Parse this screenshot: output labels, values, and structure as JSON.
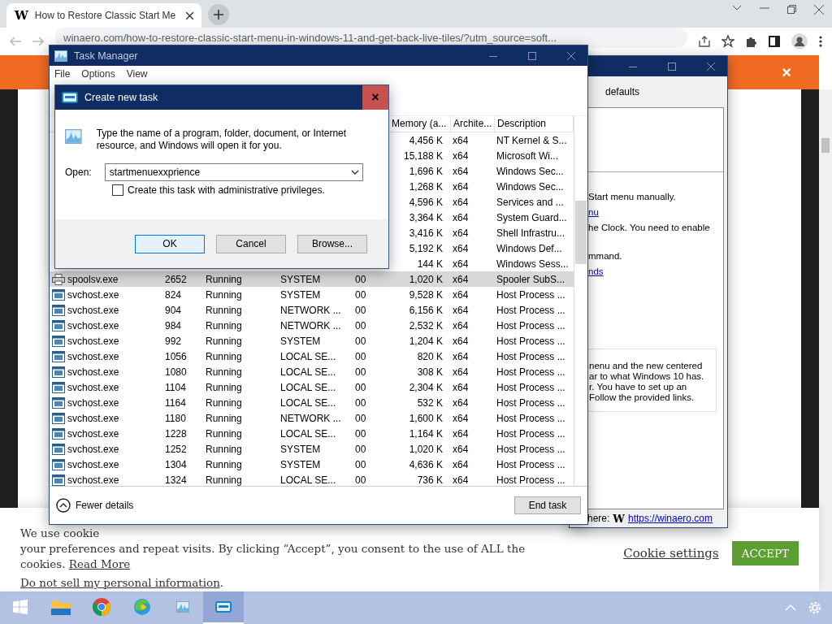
{
  "browser": {
    "tab": {
      "favicon": "W",
      "title": "How to Restore Classic Start Me"
    },
    "url": "winaero.com/how-to-restore-classic-start-menu-in-windows-11-and-get-back-live-tiles/?utm_source=soft..."
  },
  "page": {
    "banner_close": "×"
  },
  "settings_window": {
    "section": "defaults",
    "lines": [
      {
        "kind": "text",
        "text": "Start menu manually."
      },
      {
        "kind": "link",
        "text": "nu"
      },
      {
        "kind": "text",
        "text": "he Clock. You need to enable"
      },
      {
        "kind": "gap"
      },
      {
        "kind": "text",
        "text": "mmand."
      },
      {
        "kind": "link",
        "text": "nds"
      }
    ],
    "note": [
      "nenu and the new centered",
      "ar to what Windows 10 has.",
      "r. You have to set up an",
      "Follow the provided links."
    ],
    "footer_label": "here:",
    "footer_logo": "W",
    "footer_link": "https://winaero.com"
  },
  "task_manager": {
    "title": "Task Manager",
    "menu": [
      "File",
      "Options",
      "View"
    ],
    "columns": [
      "Memory (a...",
      "Archite...",
      "Description"
    ],
    "rows": [
      {
        "memory": "4,456 K",
        "arch": "x64",
        "description": "NT Kernel & S...",
        "selected": false
      },
      {
        "memory": "15,188 K",
        "arch": "x64",
        "description": "Microsoft Wi...",
        "selected": false
      },
      {
        "memory": "1,696 K",
        "arch": "x64",
        "description": "Windows Sec...",
        "selected": false
      },
      {
        "memory": "1,268 K",
        "arch": "x64",
        "description": "Windows Sec...",
        "selected": false
      },
      {
        "memory": "4,596 K",
        "arch": "x64",
        "description": "Services and ...",
        "selected": false
      },
      {
        "memory": "3,364 K",
        "arch": "x64",
        "description": "System Guard...",
        "selected": false
      },
      {
        "memory": "3,416 K",
        "arch": "x64",
        "description": "Shell Infrastru...",
        "selected": false
      },
      {
        "memory": "5,192 K",
        "arch": "x64",
        "description": "Windows Def...",
        "selected": false
      },
      {
        "memory": "144 K",
        "arch": "x64",
        "description": "Windows Sess...",
        "selected": false
      },
      {
        "kind": "printer",
        "name": "spoolsv.exe",
        "pid": "2652",
        "status": "Running",
        "user": "SYSTEM",
        "cpu": "00",
        "memory": "1,020 K",
        "arch": "x64",
        "description": "Spooler SubS...",
        "selected": true
      },
      {
        "kind": "service",
        "name": "svchost.exe",
        "pid": "824",
        "status": "Running",
        "user": "SYSTEM",
        "cpu": "00",
        "memory": "9,528 K",
        "arch": "x64",
        "description": "Host Process ...",
        "selected": false
      },
      {
        "kind": "service",
        "name": "svchost.exe",
        "pid": "904",
        "status": "Running",
        "user": "NETWORK ...",
        "cpu": "00",
        "memory": "6,156 K",
        "arch": "x64",
        "description": "Host Process ...",
        "selected": false
      },
      {
        "kind": "service",
        "name": "svchost.exe",
        "pid": "984",
        "status": "Running",
        "user": "NETWORK ...",
        "cpu": "00",
        "memory": "2,532 K",
        "arch": "x64",
        "description": "Host Process ...",
        "selected": false
      },
      {
        "kind": "service",
        "name": "svchost.exe",
        "pid": "992",
        "status": "Running",
        "user": "SYSTEM",
        "cpu": "00",
        "memory": "1,204 K",
        "arch": "x64",
        "description": "Host Process ...",
        "selected": false
      },
      {
        "kind": "service",
        "name": "svchost.exe",
        "pid": "1056",
        "status": "Running",
        "user": "LOCAL SE...",
        "cpu": "00",
        "memory": "820 K",
        "arch": "x64",
        "description": "Host Process ...",
        "selected": false
      },
      {
        "kind": "service",
        "name": "svchost.exe",
        "pid": "1080",
        "status": "Running",
        "user": "LOCAL SE...",
        "cpu": "00",
        "memory": "308 K",
        "arch": "x64",
        "description": "Host Process ...",
        "selected": false
      },
      {
        "kind": "service",
        "name": "svchost.exe",
        "pid": "1104",
        "status": "Running",
        "user": "LOCAL SE...",
        "cpu": "00",
        "memory": "2,304 K",
        "arch": "x64",
        "description": "Host Process ...",
        "selected": false
      },
      {
        "kind": "service",
        "name": "svchost.exe",
        "pid": "1164",
        "status": "Running",
        "user": "LOCAL SE...",
        "cpu": "00",
        "memory": "532 K",
        "arch": "x64",
        "description": "Host Process ...",
        "selected": false
      },
      {
        "kind": "service",
        "name": "svchost.exe",
        "pid": "1180",
        "status": "Running",
        "user": "NETWORK ...",
        "cpu": "00",
        "memory": "1,600 K",
        "arch": "x64",
        "description": "Host Process ...",
        "selected": false
      },
      {
        "kind": "service",
        "name": "svchost.exe",
        "pid": "1228",
        "status": "Running",
        "user": "LOCAL SE...",
        "cpu": "00",
        "memory": "1,164 K",
        "arch": "x64",
        "description": "Host Process ...",
        "selected": false
      },
      {
        "kind": "service",
        "name": "svchost.exe",
        "pid": "1252",
        "status": "Running",
        "user": "SYSTEM",
        "cpu": "00",
        "memory": "1,020 K",
        "arch": "x64",
        "description": "Host Process ...",
        "selected": false
      },
      {
        "kind": "service",
        "name": "svchost.exe",
        "pid": "1304",
        "status": "Running",
        "user": "SYSTEM",
        "cpu": "00",
        "memory": "4,636 K",
        "arch": "x64",
        "description": "Host Process ...",
        "selected": false
      },
      {
        "kind": "service",
        "name": "svchost.exe",
        "pid": "1324",
        "status": "Running",
        "user": "LOCAL SE...",
        "cpu": "00",
        "memory": "736 K",
        "arch": "x64",
        "description": "Host Process ...",
        "selected": false
      }
    ],
    "fewer_details": "Fewer details",
    "end_task": "End task"
  },
  "dialog": {
    "title": "Create new task",
    "close": "×",
    "description": "Type the name of a program, folder, document, or Internet resource, and Windows will open it for you.",
    "open_label": "Open:",
    "open_value": "startmenuexxprience",
    "admin_checkbox": {
      "label": "Create this task with administrative privileges.",
      "checked": false
    },
    "buttons": [
      "OK",
      "Cancel",
      "Browse..."
    ]
  },
  "cookie_banner": {
    "line_1": "We use cookie",
    "line_2": "your preferences and repeat visits. By clicking “Accept”, you consent to the use of ALL the",
    "line_3": "cookies.",
    "read_more": "Read More",
    "do_not_sell": "Do not sell my personal information",
    "do_not_sell_tail": ".",
    "settings": "Cookie settings",
    "accept": "ACCEPT"
  },
  "taskbar": {
    "apps": [
      {
        "kind": "start",
        "selected": false
      },
      {
        "kind": "folder",
        "selected": false
      },
      {
        "kind": "chrome",
        "selected": false
      },
      {
        "kind": "edge",
        "selected": false
      },
      {
        "kind": "taskmgr",
        "selected": false
      },
      {
        "kind": "run",
        "selected": true
      }
    ]
  }
}
